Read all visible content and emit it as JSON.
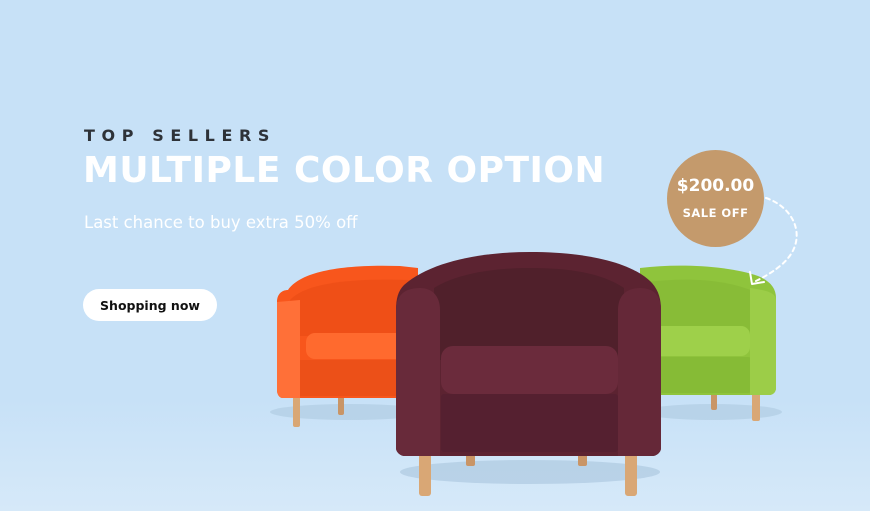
{
  "banner": {
    "eyebrow": "TOP SELLERS",
    "headline": "MULTIPLE COLOR OPTION",
    "subline": "Last chance to buy extra 50% off",
    "cta_label": "Shopping now",
    "badge": {
      "price": "$200.00",
      "label": "SALE OFF"
    }
  },
  "colors": {
    "background": "#c7e1f7",
    "badge": "#c49a6c",
    "chair_orange": "#f8561c",
    "chair_maroon": "#5c2331",
    "chair_green": "#8fc43c",
    "chair_legs": "#d9a775"
  },
  "icons": [
    "dashed-curved-arrow-icon"
  ]
}
